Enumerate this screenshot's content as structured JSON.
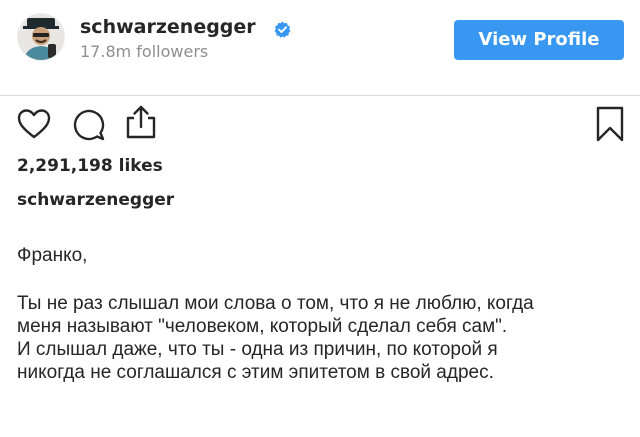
{
  "header": {
    "username": "schwarzenegger",
    "followers": "17.8m followers",
    "view_profile_label": "View Profile",
    "verified_color": "#3897f0",
    "button_color": "#3897f0"
  },
  "post": {
    "likes": "2,291,198 likes",
    "caption_username": "schwarzenegger",
    "caption_greeting": "Франко,",
    "caption_lines": [
      "Ты не раз слышал мои слова о том, что я не люблю, когда",
      "меня называют \"человеком, который сделал себя сам\".",
      "И слышал даже, что ты - одна из причин, по которой я",
      "никогда не соглашался с этим эпитетом в свой адрес."
    ]
  },
  "icons": {
    "like": "heart-icon",
    "comment": "comment-icon",
    "share": "share-icon",
    "save": "bookmark-icon",
    "verified": "verified-badge-icon"
  }
}
